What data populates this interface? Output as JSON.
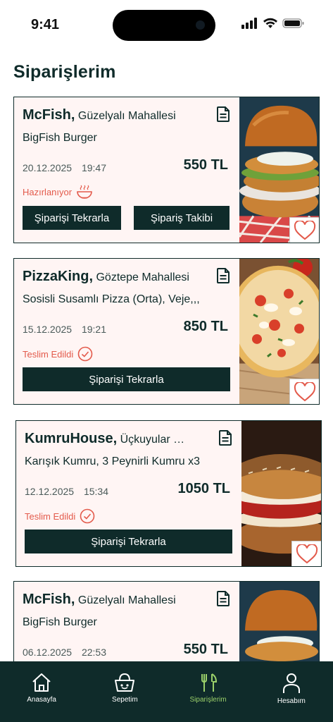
{
  "status_bar": {
    "time": "9:41"
  },
  "page_title": "Siparişlerim",
  "orders": [
    {
      "restaurant": "McFish,",
      "district": "Güzelyalı Mahallesi",
      "items": "BigFish Burger",
      "date": "20.12.2025",
      "time": "19:47",
      "price": "550 TL",
      "status": "Hazırlanıyor",
      "status_icon": "food-bowl-icon",
      "reorder_label": "Şiparişi Tekrarla",
      "track_label": "Şipariş Takibi",
      "image": "burger-image"
    },
    {
      "restaurant": "PizzaKing,",
      "district": "Göztepe Mahallesi",
      "items": "Sosisli Susamlı Pizza (Orta), Veje,,,",
      "date": "15.12.2025",
      "time": "19:21",
      "price": "850 TL",
      "status": "Teslim Edildi",
      "status_icon": "check-circle-icon",
      "reorder_label": "Şiparişi Tekrarla",
      "image": "pizza-image"
    },
    {
      "restaurant": "KumruHouse,",
      "district": "Üçkuyular Ma...",
      "items": "Karışık Kumru, 3 Peynirli Kumru x3",
      "date": "12.12.2025",
      "time": "15:34",
      "price": "1050 TL",
      "status": "Teslim Edildi",
      "status_icon": "check-circle-icon",
      "reorder_label": "Şiparişi Tekrarla",
      "image": "kumru-image"
    },
    {
      "restaurant": "McFish,",
      "district": "Güzelyalı Mahallesi",
      "items": "BigFish Burger",
      "date": "06.12.2025",
      "time": "22:53",
      "price": "550 TL",
      "image": "burger-image"
    }
  ],
  "bottom_nav": [
    {
      "label": "Anasayfa",
      "icon": "home-icon"
    },
    {
      "label": "Sepetim",
      "icon": "basket-icon"
    },
    {
      "label": "Siparişlerim",
      "icon": "fork-knife-icon",
      "active": true
    },
    {
      "label": "Hesabım",
      "icon": "user-icon"
    }
  ],
  "colors": {
    "primary": "#0f2b2a",
    "card_bg": "#fff5f4",
    "status_red": "#e35a4b",
    "nav_active": "#9bd06a"
  }
}
